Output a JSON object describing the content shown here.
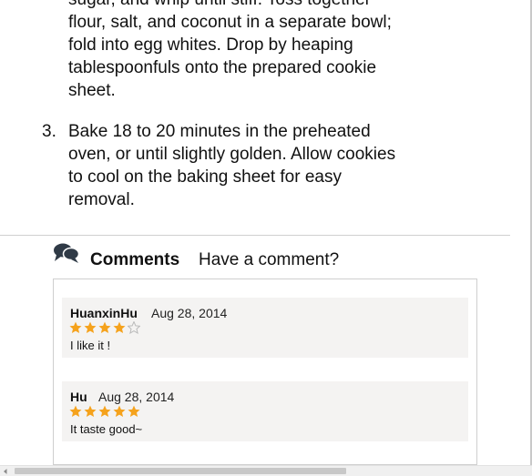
{
  "directions": {
    "previous_step_lines": [
      "sugar, and whip until stiff. Toss together",
      "flour, salt, and coconut in a separate bowl;",
      "fold into egg whites. Drop by heaping",
      "tablespoonfuls onto the prepared cookie",
      "sheet."
    ],
    "step3": {
      "number": "3.",
      "lines": [
        "Bake 18 to 20 minutes in the preheated",
        "oven, or until slightly golden. Allow cookies",
        "to cool on the baking sheet for easy",
        "removal."
      ]
    }
  },
  "comments": {
    "icon": "speech-bubbles-icon",
    "title": "Comments",
    "prompt": "Have a comment?",
    "items": [
      {
        "author": "HuanxinHu",
        "date": "Aug 28, 2014",
        "rating": 4,
        "max_rating": 5,
        "text": "I like it !"
      },
      {
        "author": "Hu",
        "date": "Aug 28, 2014",
        "rating": 5,
        "max_rating": 5,
        "text": "It taste good~"
      }
    ]
  },
  "colors": {
    "star_filled": "#f5a21c",
    "star_empty": "#b9b9b9",
    "comment_bg": "#f4f3f2",
    "icon": "#2f3a46"
  }
}
